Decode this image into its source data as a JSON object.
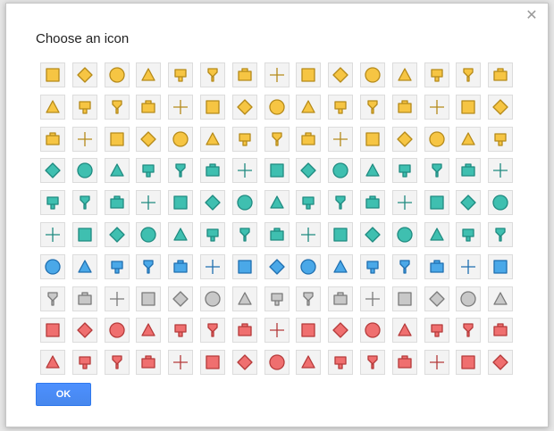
{
  "dialog": {
    "title": "Choose an icon",
    "close_glyph": "✕",
    "ok_label": "OK"
  },
  "colors": {
    "yellow": "#f6c543",
    "yellow_stroke": "#b58a1a",
    "teal": "#3fbfb0",
    "teal_stroke": "#1f8a80",
    "blue": "#4aa8e8",
    "blue_stroke": "#1f6fb0",
    "gray": "#c8c8c8",
    "gray_stroke": "#7a7a7a",
    "red": "#ef6f6f",
    "red_stroke": "#b53a3a"
  },
  "icon_rows": [
    [
      "utensils-icon",
      "coffee-cup-icon",
      "cocktail-icon",
      "thumbs-up-icon",
      "bowl-icon",
      "shopping-bag-icon",
      "film-icon",
      "thumbs-up-alt-icon",
      "shopping-cart-icon",
      "smile-icon",
      "heart-icon",
      "flower-icon",
      "gift-icon",
      "music-note-icon",
      "house-icon"
    ],
    [
      "computer-icon",
      "wrench-icon",
      "gas-station-icon",
      "house-alt-icon",
      "scissors-icon",
      "dollar-icon",
      "euro-icon",
      "yen-icon",
      "bed-icon",
      "camera-icon",
      "envelope-icon",
      "video-camera-icon",
      "dog-icon",
      "flag-icon",
      "home-icon"
    ],
    [
      "question-icon",
      "info-italic-icon",
      "info-icon",
      "cross-icon",
      "parking-icon",
      "phone-icon",
      "star-person-icon",
      "baby-icon",
      "bathtub-icon",
      "person-icon",
      "restroom-icon",
      "woman-icon",
      "wheelchair-icon",
      "tennis-ball-icon",
      "basketball-icon"
    ],
    [
      "golf-icon",
      "bowling-icon",
      "sledding-icon",
      "hockey-icon",
      "fish-icon",
      "football-icon",
      "runner-icon",
      "family-icon",
      "horse-icon",
      "boat-ramp-icon",
      "mountain-icon",
      "tree-icon",
      "picnic-table-icon",
      "swing-icon",
      "blank-icon"
    ],
    [
      "checkered-flag-icon",
      "sailboat-icon",
      "skater-icon",
      "waves-icon",
      "climbing-icon",
      "swimmer-icon",
      "magnifier-icon",
      "binoculars-icon",
      "train-icon",
      "dome-icon",
      "ferris-wheel-icon",
      "skier-icon",
      "snowboarder-icon",
      "skiing-icon",
      "blank-icon"
    ],
    [
      "snowflake-icon",
      "airplane-icon",
      "bicycle-icon",
      "ship-icon",
      "bus-icon",
      "cable-car-icon",
      "speedboat-icon",
      "ferry-icon",
      "gate-icon",
      "tram-icon",
      "motor-home-icon",
      "helicopter-icon",
      "airplane-stand-icon",
      "cruise-ship-icon",
      "anchor-icon"
    ],
    [
      "metro-icon",
      "subway-icon",
      "motorcycle-icon",
      "bike-icon",
      "parking-blue-icon",
      "van-icon",
      "car-icon",
      "train-front-icon",
      "police-car-icon",
      "coach-icon",
      "truck-icon",
      "tunnel-icon",
      "walker-icon",
      "sun-cloud-icon",
      "cloud-icon"
    ],
    [
      "sunset-icon",
      "partly-cloudy-icon",
      "rain-icon",
      "sleet-icon",
      "snow-icon",
      "sun-icon",
      "thunder-icon",
      "shark-fin-icon",
      "factory-icon",
      "paw-icon",
      "biohazard-icon",
      "warning-icon",
      "flask-icon",
      "megaphone-icon",
      "pistol-icon"
    ],
    [
      "hurricane-icon",
      "tropical-storm-icon",
      "poison-icon",
      "heartbeat-icon",
      "lightning-icon",
      "target-icon",
      "explosion-icon",
      "fire-icon",
      "flooded-house-icon",
      "cyclone-icon",
      "typhoon-icon",
      "skull-warning-icon",
      "animal-icon",
      "gecko-icon",
      "landslide-icon"
    ],
    [
      "person-alert-icon",
      "virus-icon",
      "radiation-icon",
      "skull-icon",
      "bandage-icon",
      "lightning-bolt-icon",
      "thermometer-icon",
      "tornado-icon",
      "wind-icon",
      "tsunami-icon",
      "volcano-icon",
      "camel-icon",
      "bird-icon",
      "pinwheel-icon",
      "tree-alert-icon"
    ]
  ],
  "row_palette": [
    "yellow",
    "yellow",
    "yellow",
    "teal",
    "teal",
    "teal",
    "blue",
    "gray",
    "red",
    "red"
  ]
}
